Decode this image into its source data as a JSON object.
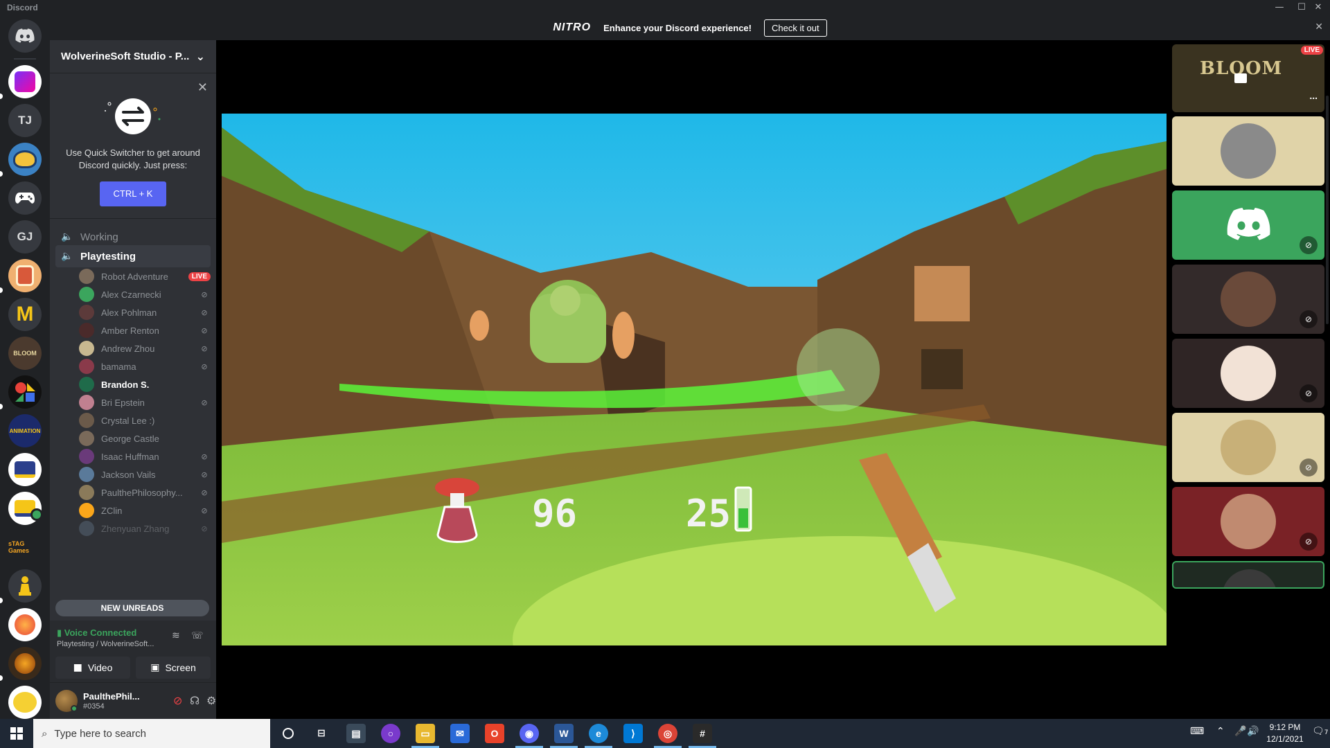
{
  "window": {
    "app_name": "Discord",
    "minimize": "—",
    "maximize": "☐",
    "close": "✕"
  },
  "rail": {
    "servers": [
      {
        "name": "discord-home",
        "label": "",
        "color": "#36393f"
      },
      {
        "name": "server-purple",
        "label": "",
        "color": "#ffffff"
      },
      {
        "name": "server-tj",
        "label": "TJ",
        "color": "#36393f"
      },
      {
        "name": "server-wolverine-blue",
        "label": "",
        "color": "#3b82c4"
      },
      {
        "name": "server-controller",
        "label": "",
        "color": "#36393f"
      },
      {
        "name": "server-gj",
        "label": "GJ",
        "color": "#36393f"
      },
      {
        "name": "server-jar",
        "label": "",
        "color": "#f0b070"
      },
      {
        "name": "server-m",
        "label": "M",
        "color": "#36393f"
      },
      {
        "name": "server-bloom",
        "label": "",
        "color": "#4b3a2e"
      },
      {
        "name": "server-shapes",
        "label": "",
        "color": "#111111"
      },
      {
        "name": "server-animation",
        "label": "ANIMATION",
        "color": "#1b2a6b"
      },
      {
        "name": "server-wolverinesoft",
        "label": "",
        "color": "#ffffff"
      },
      {
        "name": "server-wolverinesoft-2",
        "label": "",
        "color": "#ffffff"
      },
      {
        "name": "server-stag",
        "label": "sTAG Games",
        "color": "#202225"
      },
      {
        "name": "server-chess",
        "label": "",
        "color": "#36393f"
      },
      {
        "name": "server-flame",
        "label": "",
        "color": "#ffffff"
      },
      {
        "name": "server-gamers",
        "label": "",
        "color": "#3a2a1a"
      },
      {
        "name": "server-pikachu",
        "label": "",
        "color": "#ffffff"
      }
    ]
  },
  "server": {
    "title": "WolverineSoft Studio - P...",
    "chevron": "⌄"
  },
  "quick_switcher": {
    "text": "Use Quick Switcher to get around Discord quickly. Just press:",
    "button": "CTRL + K",
    "close": "✕"
  },
  "channels": [
    {
      "name": "Working",
      "active": false
    },
    {
      "name": "Playtesting",
      "active": true
    }
  ],
  "members": [
    {
      "name": "Robot Adventure",
      "live": "LIVE",
      "muted": false,
      "color": "#7a6a5a",
      "bold": false
    },
    {
      "name": "Alex Czarnecki",
      "muted": true,
      "color": "#3ba55d",
      "bold": false
    },
    {
      "name": "Alex Pohlman",
      "muted": true,
      "color": "#5c3a3a",
      "bold": false
    },
    {
      "name": "Amber Renton",
      "muted": true,
      "color": "#4a2a2a",
      "bold": false
    },
    {
      "name": "Andrew Zhou",
      "muted": true,
      "color": "#c8b890",
      "bold": false
    },
    {
      "name": "bamama",
      "muted": true,
      "color": "#8a3a4a",
      "bold": false
    },
    {
      "name": "Brandon S.",
      "muted": false,
      "color": "#1f6b4a",
      "bold": true
    },
    {
      "name": "Bri Epstein",
      "muted": true,
      "color": "#c08090",
      "bold": false
    },
    {
      "name": "Crystal Lee :)",
      "muted": false,
      "color": "#6b5a4a",
      "bold": false
    },
    {
      "name": "George Castle",
      "muted": false,
      "color": "#7a6a5a",
      "bold": false
    },
    {
      "name": "Isaac Huffman",
      "muted": true,
      "color": "#6a3a7a",
      "bold": false
    },
    {
      "name": "Jackson Vails",
      "muted": true,
      "color": "#5a7a9a",
      "bold": false
    },
    {
      "name": "PaulthePhilosophy...",
      "muted": true,
      "color": "#8a7a5a",
      "bold": false
    },
    {
      "name": "ZClin",
      "muted": true,
      "color": "#faa61a",
      "bold": false
    },
    {
      "name": "Zhenyuan Zhang",
      "muted": true,
      "color": "#5a6a7a",
      "bold": false
    }
  ],
  "new_unreads": "NEW UNREADS",
  "voice": {
    "status": "Voice Connected",
    "location": "Playtesting / WolverineSoft...",
    "video": "Video",
    "screen": "Screen"
  },
  "user": {
    "name": "PaulthePhil...",
    "tag": "#0354"
  },
  "nitro": {
    "logo": "NITRO",
    "message": "Enhance your Discord experience!",
    "cta": "Check it out",
    "close": "✕"
  },
  "stream": {
    "live": "LIVE",
    "more": "...",
    "game_title": "BLOOM",
    "health": "96",
    "mana": "25"
  },
  "tiles": [
    {
      "name": "tile-robot",
      "bg": "#e0d3a8",
      "avatar": "#8a8a8a",
      "muted": false
    },
    {
      "name": "tile-discord",
      "bg": "#3ba55d",
      "avatar": "discord",
      "muted": true
    },
    {
      "name": "tile-dark-photo",
      "bg": "#332a2a",
      "avatar": "#6a4a3a",
      "muted": true
    },
    {
      "name": "tile-anime",
      "bg": "#2f2525",
      "avatar": "#f2e2d6",
      "muted": true
    },
    {
      "name": "tile-glasses",
      "bg": "#e0d3a8",
      "avatar": "#c8b078",
      "muted": true
    },
    {
      "name": "tile-couple",
      "bg": "#7a2226",
      "avatar": "#c08a70",
      "muted": true
    },
    {
      "name": "tile-partial",
      "bg": "#1f2a22",
      "avatar": "#3a3a3a",
      "muted": false
    }
  ],
  "taskbar": {
    "search_placeholder": "Type here to search",
    "time": "9:12 PM",
    "date": "12/1/2021",
    "notifications": "7"
  }
}
